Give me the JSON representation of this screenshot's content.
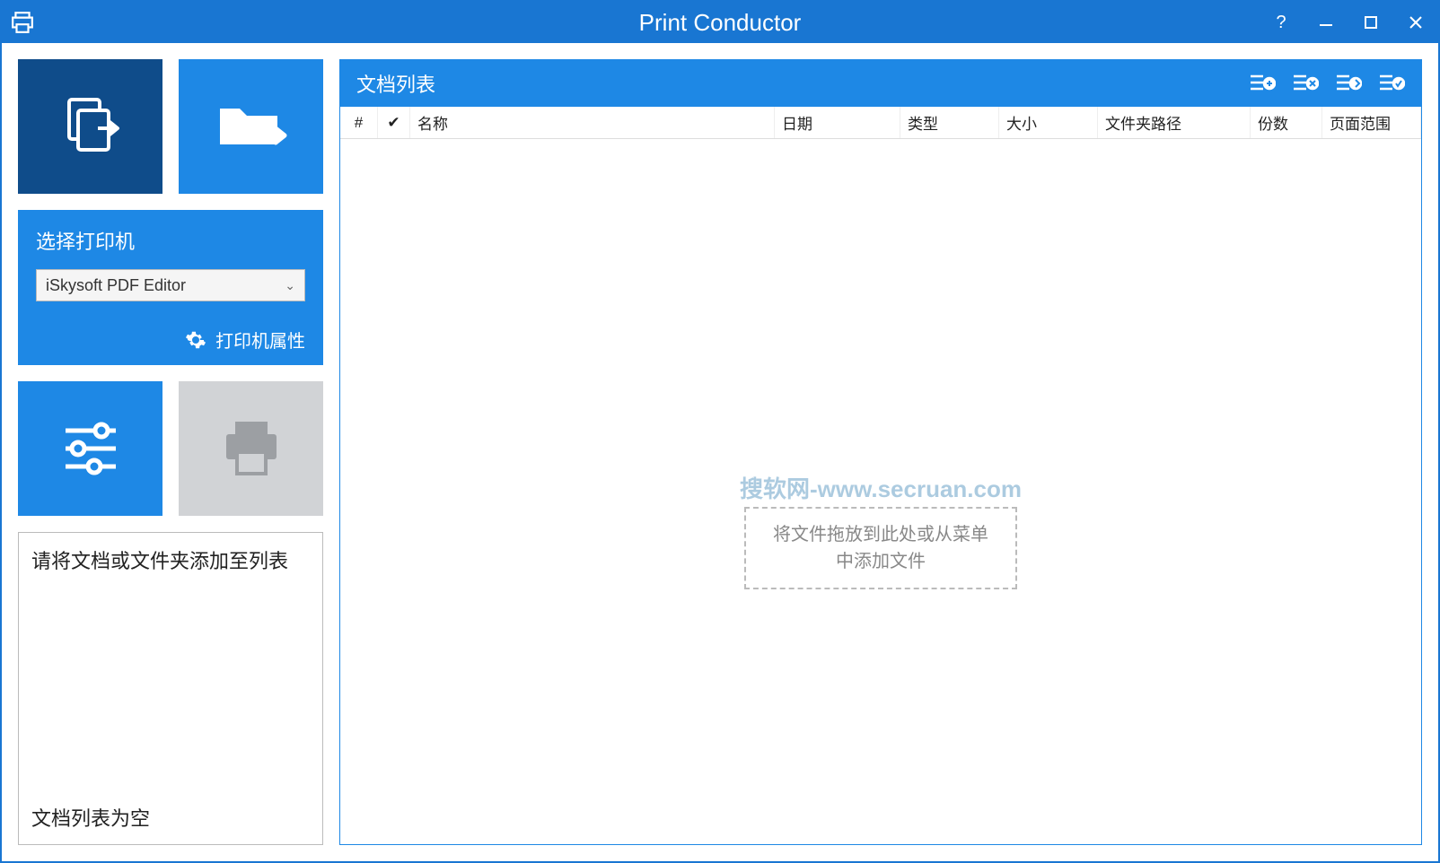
{
  "titlebar": {
    "title": "Print Conductor"
  },
  "sidebar": {
    "printer_panel_title": "选择打印机",
    "printer_selected": "iSkysoft PDF Editor",
    "printer_props": "打印机属性"
  },
  "status": {
    "line1": "请将文档或文件夹添加至列表",
    "line2": "文档列表为空"
  },
  "list": {
    "title": "文档列表",
    "columns": {
      "num": "#",
      "check": "✔",
      "name": "名称",
      "date": "日期",
      "type": "类型",
      "size": "大小",
      "path": "文件夹路径",
      "copies": "份数",
      "range": "页面范围"
    },
    "watermark": "搜软网-www.secruan.com",
    "dropzone_l1": "将文件拖放到此处或从菜单",
    "dropzone_l2": "中添加文件"
  }
}
